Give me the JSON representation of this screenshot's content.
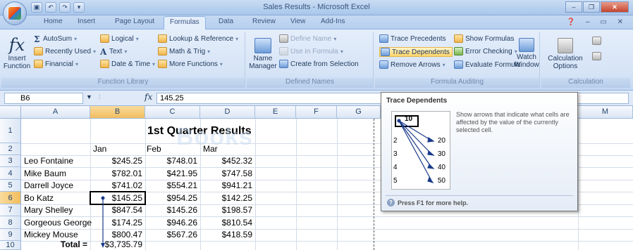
{
  "window": {
    "title": "Sales Results - Microsoft Excel"
  },
  "qat": {
    "save": "▣",
    "undo": "↶",
    "redo": "↷",
    "more": "▾"
  },
  "window_controls": {
    "minimize": "–",
    "restore": "❐",
    "close": "✕"
  },
  "ribbon_tabs": [
    "Home",
    "Insert",
    "Page Layout",
    "Formulas",
    "Data",
    "Review",
    "View",
    "Add-Ins"
  ],
  "ribbon": {
    "function_library": {
      "label": "Function Library",
      "insert_function": "Insert Function",
      "autosum": "AutoSum",
      "recently_used": "Recently Used",
      "financial": "Financial",
      "logical": "Logical",
      "text": "Text",
      "date_time": "Date & Time",
      "lookup_reference": "Lookup & Reference",
      "math_trig": "Math & Trig",
      "more_functions": "More Functions"
    },
    "defined_names": {
      "label": "Defined Names",
      "name_manager": "Name Manager",
      "define_name": "Define Name",
      "use_in_formula": "Use in Formula",
      "create_from_selection": "Create from Selection"
    },
    "formula_auditing": {
      "label": "Formula Auditing",
      "trace_precedents": "Trace Precedents",
      "trace_dependents": "Trace Dependents",
      "remove_arrows": "Remove Arrows",
      "show_formulas": "Show Formulas",
      "error_checking": "Error Checking",
      "evaluate_formula": "Evaluate Formula",
      "watch_window": "Watch Window"
    },
    "calculation": {
      "label": "Calculation",
      "calculation_options": "Calculation Options"
    }
  },
  "formula_bar": {
    "name_box": "B6",
    "fx": "fx",
    "value": "145.25"
  },
  "columns": [
    "A",
    "B",
    "C",
    "D",
    "E",
    "F",
    "G",
    "M"
  ],
  "rows": [
    "1",
    "2",
    "3",
    "4",
    "5",
    "6",
    "7",
    "8",
    "9",
    "10"
  ],
  "sheet": {
    "title": "1st Quarter Results",
    "headers": [
      "Jan",
      "Feb",
      "Mar"
    ],
    "data": [
      {
        "name": "Leo Fontaine",
        "jan": "$245.25",
        "feb": "$748.01",
        "mar": "$452.32"
      },
      {
        "name": "Mike Baum",
        "jan": "$782.01",
        "feb": "$421.95",
        "mar": "$747.58"
      },
      {
        "name": "Darrell Joyce",
        "jan": "$741.02",
        "feb": "$554.21",
        "mar": "$941.21"
      },
      {
        "name": "Bo Katz",
        "jan": "$145.25",
        "feb": "$954.25",
        "mar": "$142.25"
      },
      {
        "name": "Mary Shelley",
        "jan": "$847.54",
        "feb": "$145.26",
        "mar": "$198.57"
      },
      {
        "name": "Gorgeous George",
        "jan": "$174.25",
        "feb": "$946.26",
        "mar": "$810.54"
      },
      {
        "name": "Mickey Mouse",
        "jan": "$800.47",
        "feb": "$567.26",
        "mar": "$418.59"
      }
    ],
    "total_label": "Total =",
    "total_value": "$3,735.79"
  },
  "tooltip": {
    "title": "Trace Dependents",
    "description": "Show arrows that indicate what cells are affected by the value of the currently selected cell.",
    "example": {
      "source": "10",
      "rows": [
        {
          "row": "2",
          "value": "20"
        },
        {
          "row": "3",
          "value": "30"
        },
        {
          "row": "4",
          "value": "40"
        },
        {
          "row": "5",
          "value": "50"
        }
      ]
    },
    "help": "Press F1 for more help."
  },
  "watermark": "Books"
}
